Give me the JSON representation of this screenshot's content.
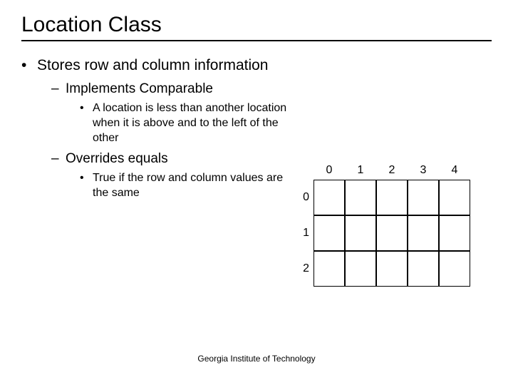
{
  "title": "Location Class",
  "bullets": {
    "b1": "Stores row and column information",
    "b1_1": "Implements Comparable",
    "b1_1_1": "A location is less than another location when it is above and to the left of the other",
    "b1_2": "Overrides equals",
    "b1_2_1": "True if the row and column values are the same"
  },
  "grid": {
    "cols": [
      "0",
      "1",
      "2",
      "3",
      "4"
    ],
    "rows": [
      "0",
      "1",
      "2"
    ]
  },
  "footer": "Georgia Institute of Technology"
}
